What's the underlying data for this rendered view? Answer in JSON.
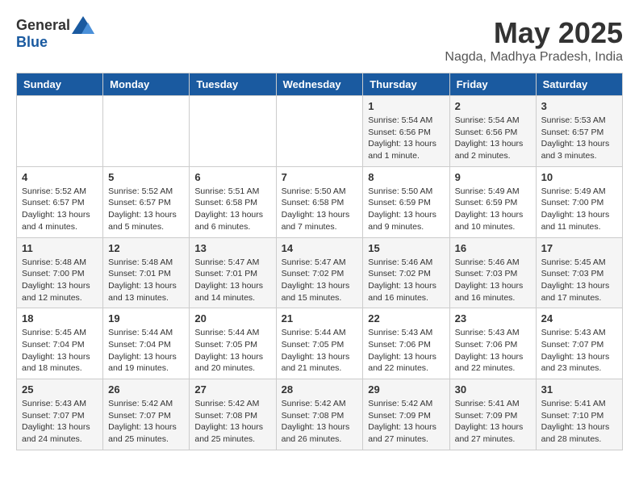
{
  "logo": {
    "general": "General",
    "blue": "Blue"
  },
  "title": "May 2025",
  "location": "Nagda, Madhya Pradesh, India",
  "weekdays": [
    "Sunday",
    "Monday",
    "Tuesday",
    "Wednesday",
    "Thursday",
    "Friday",
    "Saturday"
  ],
  "weeks": [
    [
      {
        "day": "",
        "info": ""
      },
      {
        "day": "",
        "info": ""
      },
      {
        "day": "",
        "info": ""
      },
      {
        "day": "",
        "info": ""
      },
      {
        "day": "1",
        "info": "Sunrise: 5:54 AM\nSunset: 6:56 PM\nDaylight: 13 hours and 1 minute."
      },
      {
        "day": "2",
        "info": "Sunrise: 5:54 AM\nSunset: 6:56 PM\nDaylight: 13 hours and 2 minutes."
      },
      {
        "day": "3",
        "info": "Sunrise: 5:53 AM\nSunset: 6:57 PM\nDaylight: 13 hours and 3 minutes."
      }
    ],
    [
      {
        "day": "4",
        "info": "Sunrise: 5:52 AM\nSunset: 6:57 PM\nDaylight: 13 hours and 4 minutes."
      },
      {
        "day": "5",
        "info": "Sunrise: 5:52 AM\nSunset: 6:57 PM\nDaylight: 13 hours and 5 minutes."
      },
      {
        "day": "6",
        "info": "Sunrise: 5:51 AM\nSunset: 6:58 PM\nDaylight: 13 hours and 6 minutes."
      },
      {
        "day": "7",
        "info": "Sunrise: 5:50 AM\nSunset: 6:58 PM\nDaylight: 13 hours and 7 minutes."
      },
      {
        "day": "8",
        "info": "Sunrise: 5:50 AM\nSunset: 6:59 PM\nDaylight: 13 hours and 9 minutes."
      },
      {
        "day": "9",
        "info": "Sunrise: 5:49 AM\nSunset: 6:59 PM\nDaylight: 13 hours and 10 minutes."
      },
      {
        "day": "10",
        "info": "Sunrise: 5:49 AM\nSunset: 7:00 PM\nDaylight: 13 hours and 11 minutes."
      }
    ],
    [
      {
        "day": "11",
        "info": "Sunrise: 5:48 AM\nSunset: 7:00 PM\nDaylight: 13 hours and 12 minutes."
      },
      {
        "day": "12",
        "info": "Sunrise: 5:48 AM\nSunset: 7:01 PM\nDaylight: 13 hours and 13 minutes."
      },
      {
        "day": "13",
        "info": "Sunrise: 5:47 AM\nSunset: 7:01 PM\nDaylight: 13 hours and 14 minutes."
      },
      {
        "day": "14",
        "info": "Sunrise: 5:47 AM\nSunset: 7:02 PM\nDaylight: 13 hours and 15 minutes."
      },
      {
        "day": "15",
        "info": "Sunrise: 5:46 AM\nSunset: 7:02 PM\nDaylight: 13 hours and 16 minutes."
      },
      {
        "day": "16",
        "info": "Sunrise: 5:46 AM\nSunset: 7:03 PM\nDaylight: 13 hours and 16 minutes."
      },
      {
        "day": "17",
        "info": "Sunrise: 5:45 AM\nSunset: 7:03 PM\nDaylight: 13 hours and 17 minutes."
      }
    ],
    [
      {
        "day": "18",
        "info": "Sunrise: 5:45 AM\nSunset: 7:04 PM\nDaylight: 13 hours and 18 minutes."
      },
      {
        "day": "19",
        "info": "Sunrise: 5:44 AM\nSunset: 7:04 PM\nDaylight: 13 hours and 19 minutes."
      },
      {
        "day": "20",
        "info": "Sunrise: 5:44 AM\nSunset: 7:05 PM\nDaylight: 13 hours and 20 minutes."
      },
      {
        "day": "21",
        "info": "Sunrise: 5:44 AM\nSunset: 7:05 PM\nDaylight: 13 hours and 21 minutes."
      },
      {
        "day": "22",
        "info": "Sunrise: 5:43 AM\nSunset: 7:06 PM\nDaylight: 13 hours and 22 minutes."
      },
      {
        "day": "23",
        "info": "Sunrise: 5:43 AM\nSunset: 7:06 PM\nDaylight: 13 hours and 22 minutes."
      },
      {
        "day": "24",
        "info": "Sunrise: 5:43 AM\nSunset: 7:07 PM\nDaylight: 13 hours and 23 minutes."
      }
    ],
    [
      {
        "day": "25",
        "info": "Sunrise: 5:43 AM\nSunset: 7:07 PM\nDaylight: 13 hours and 24 minutes."
      },
      {
        "day": "26",
        "info": "Sunrise: 5:42 AM\nSunset: 7:07 PM\nDaylight: 13 hours and 25 minutes."
      },
      {
        "day": "27",
        "info": "Sunrise: 5:42 AM\nSunset: 7:08 PM\nDaylight: 13 hours and 25 minutes."
      },
      {
        "day": "28",
        "info": "Sunrise: 5:42 AM\nSunset: 7:08 PM\nDaylight: 13 hours and 26 minutes."
      },
      {
        "day": "29",
        "info": "Sunrise: 5:42 AM\nSunset: 7:09 PM\nDaylight: 13 hours and 27 minutes."
      },
      {
        "day": "30",
        "info": "Sunrise: 5:41 AM\nSunset: 7:09 PM\nDaylight: 13 hours and 27 minutes."
      },
      {
        "day": "31",
        "info": "Sunrise: 5:41 AM\nSunset: 7:10 PM\nDaylight: 13 hours and 28 minutes."
      }
    ]
  ]
}
